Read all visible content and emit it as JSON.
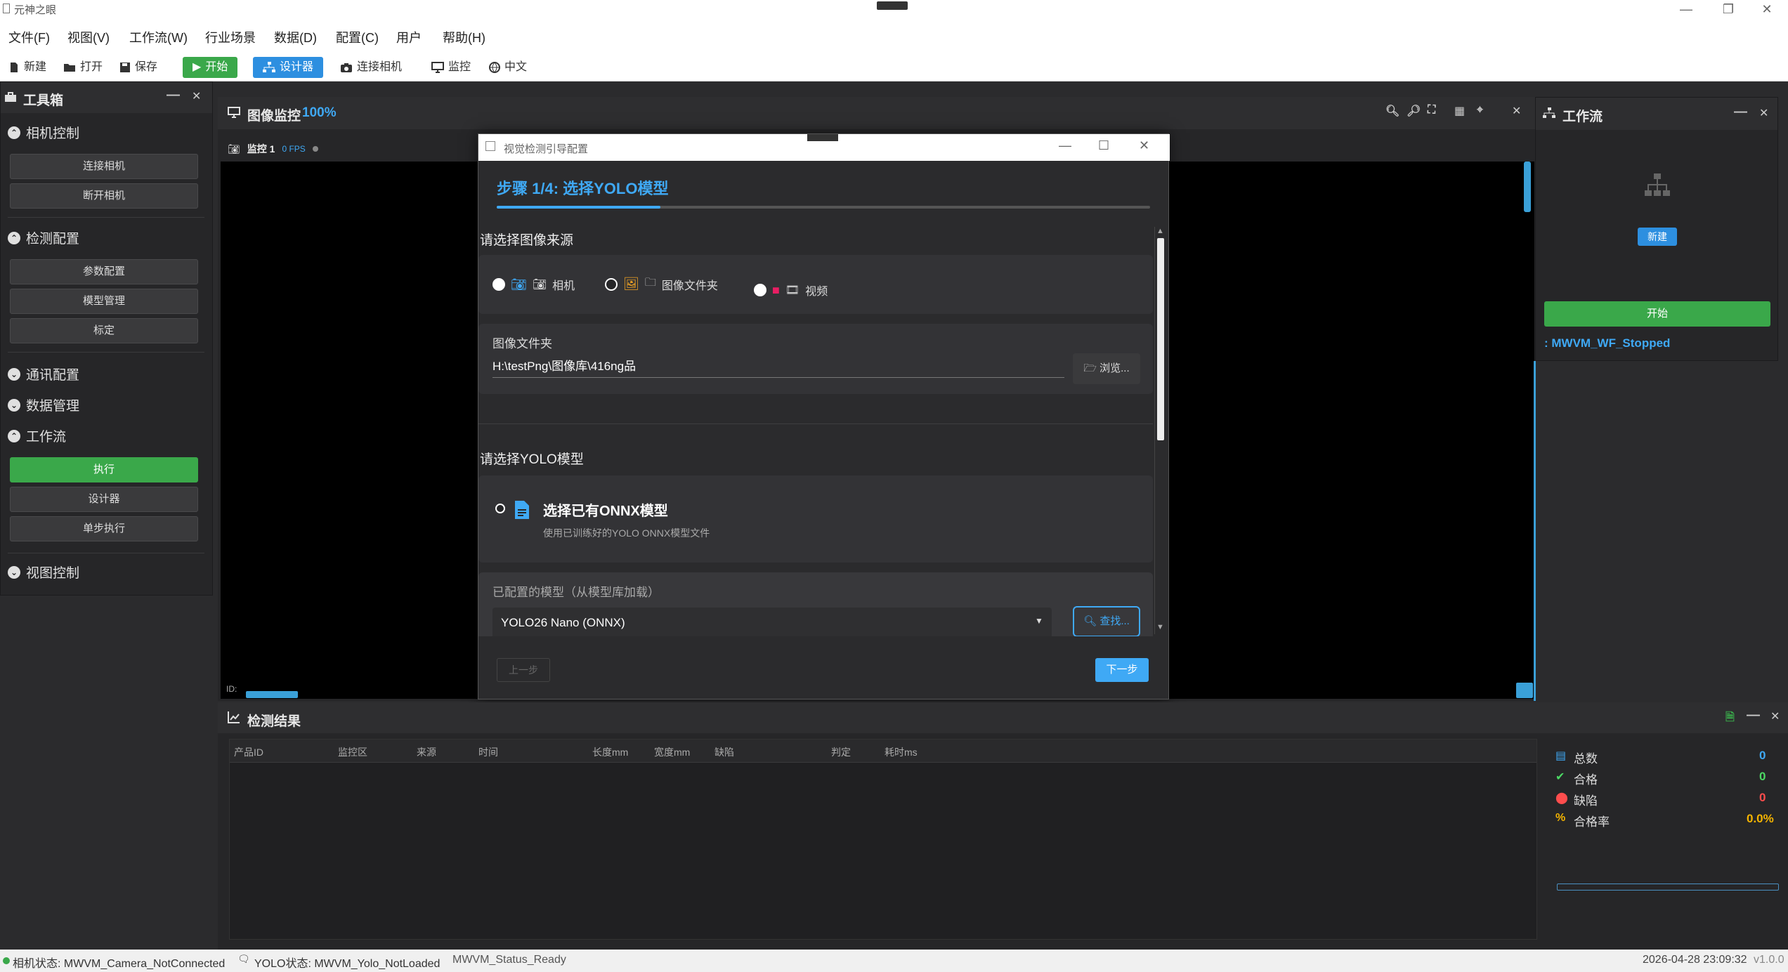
{
  "window": {
    "title": "元神之眼",
    "min": "—",
    "restore": "❐",
    "close": "✕"
  },
  "menu": [
    "文件(F)",
    "视图(V)",
    "工作流(W)",
    "行业场景",
    "数据(D)",
    "配置(C)",
    "用户",
    "帮助(H)"
  ],
  "toolbar": {
    "new": "新建",
    "open": "打开",
    "save": "保存",
    "start": "开始",
    "designer": "设计器",
    "connect_camera": "连接相机",
    "monitor": "监控",
    "language": "中文"
  },
  "toolbox": {
    "title": "工具箱",
    "camera_control": {
      "title": "相机控制",
      "connect": "连接相机",
      "disconnect": "断开相机"
    },
    "detection_config": {
      "title": "检测配置",
      "params": "参数配置",
      "models": "模型管理",
      "calibrate": "标定"
    },
    "comm_config": {
      "title": "通讯配置"
    },
    "data_mgmt": {
      "title": "数据管理"
    },
    "workflow": {
      "title": "工作流",
      "execute": "执行",
      "designer": "设计器",
      "step": "单步执行"
    },
    "view_control": {
      "title": "视图控制"
    }
  },
  "monitor": {
    "title": "图像监控",
    "zoom": "100%",
    "tab_label": "监控 1",
    "fps": "0 FPS",
    "id_label": "ID:"
  },
  "dialog": {
    "title": "视觉检测引导配置",
    "step_title": "步骤 1/4: 选择YOLO模型",
    "progress": 0.25,
    "image_source_label": "请选择图像来源",
    "sources": {
      "camera": "相机",
      "folder": "图像文件夹",
      "video": "视频"
    },
    "folder_label": "图像文件夹",
    "folder_path": "H:\\testPng\\图像库\\416ng品",
    "browse": "浏览...",
    "model_label": "请选择YOLO模型",
    "onnx_option_title": "选择已有ONNX模型",
    "onnx_option_desc": "使用已训练好的YOLO ONNX模型文件",
    "configured_label": "已配置的模型（从模型库加载）",
    "selected_model": "YOLO26 Nano (ONNX)",
    "find": "查找...",
    "prev": "上一步",
    "next": "下一步"
  },
  "workflow_panel": {
    "title": "工作流",
    "new": "新建",
    "start": "开始",
    "status": ": MWVM_WF_Stopped"
  },
  "results": {
    "title": "检测结果",
    "columns": [
      "产品ID",
      "监控区",
      "来源",
      "时间",
      "长度mm",
      "宽度mm",
      "缺陷",
      "判定",
      "耗时ms"
    ],
    "stats": [
      {
        "label": "总数",
        "value": "0",
        "color": "#3fa9f5"
      },
      {
        "label": "合格",
        "value": "0",
        "color": "#4cd964"
      },
      {
        "label": "缺陷",
        "value": "0",
        "color": "#ff4d4d"
      },
      {
        "label": "合格率",
        "value": "0.0%",
        "color": "#f5b400"
      }
    ]
  },
  "status": {
    "camera": "相机状态: MWVM_Camera_NotConnected",
    "yolo": "YOLO状态: MWVM_Yolo_NotLoaded",
    "ready": "MWVM_Status_Ready",
    "datetime": "2026-04-28 23:09:32",
    "version": "v1.0.0"
  },
  "colors": {
    "accent": "#2d8fe0",
    "green": "#3aa84a",
    "step_blue": "#3fa9f5"
  }
}
